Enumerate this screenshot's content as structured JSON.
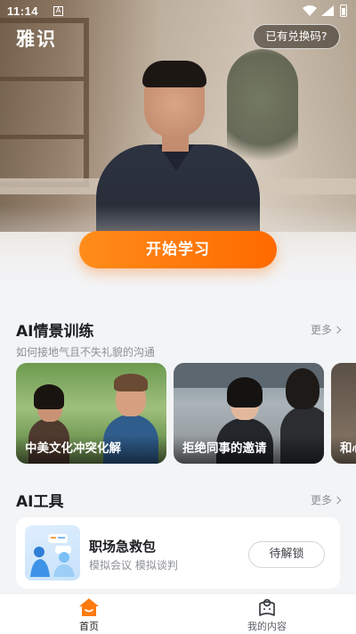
{
  "status_bar": {
    "time": "11:14"
  },
  "header": {
    "app_title": "雅识",
    "redeem_label": "已有兑换码?"
  },
  "hero": {
    "start_label": "开始学习"
  },
  "scene_training": {
    "title": "AI情景训练",
    "subtitle": "如何接地气且不失礼貌的沟通",
    "more_label": "更多",
    "cards": [
      {
        "label": "中美文化冲突化解"
      },
      {
        "label": "拒绝同事的邀请"
      },
      {
        "label": "和心"
      }
    ]
  },
  "ai_tools": {
    "title": "AI工具",
    "more_label": "更多",
    "items": [
      {
        "name": "职场急救包",
        "desc": "模拟会议 模拟谈判",
        "action_label": "待解锁"
      }
    ]
  },
  "tabbar": {
    "items": [
      {
        "label": "首页",
        "icon": "home-icon",
        "active": true
      },
      {
        "label": "我的内容",
        "icon": "book-icon",
        "active": false
      }
    ]
  },
  "colors": {
    "accent": "#ff7a0f",
    "background": "#f3f4f6"
  }
}
